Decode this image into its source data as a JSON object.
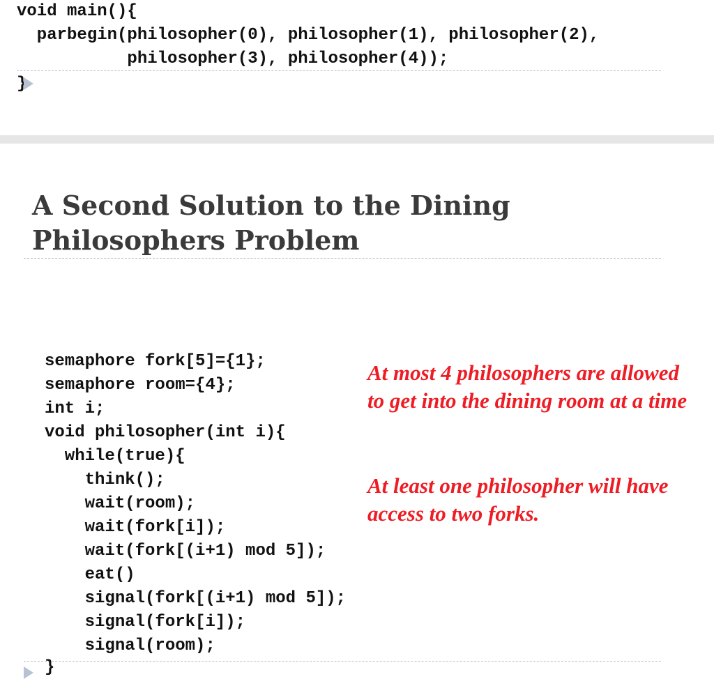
{
  "top_code": {
    "lines": [
      "void main(){",
      "  parbegin(philosopher(0), philosopher(1), philosopher(2),",
      "           philosopher(3), philosopher(4));"
    ],
    "closing_brace": "}"
  },
  "slide": {
    "title": "A Second Solution to the Dining Philosophers Problem",
    "code_lines": [
      "semaphore fork[5]={1};",
      "semaphore room={4};",
      "int i;",
      "void philosopher(int i){",
      "  while(true){",
      "    think();",
      "    wait(room);",
      "    wait(fork[i]);",
      "    wait(fork[(i+1) mod 5]);",
      "    eat()",
      "    signal(fork[(i+1) mod 5]);",
      "    signal(fork[i]);",
      "    signal(room);"
    ],
    "closing_brace": "}",
    "notes": [
      "At most 4 philosophers are allowed to get into the dining room at a time",
      "At least one philosopher will have access to two forks."
    ]
  },
  "colors": {
    "note_text": "#ee1c24",
    "title_text": "#3a3a3a",
    "marker": "#b7c3d3",
    "band": "#e6e6e6"
  }
}
